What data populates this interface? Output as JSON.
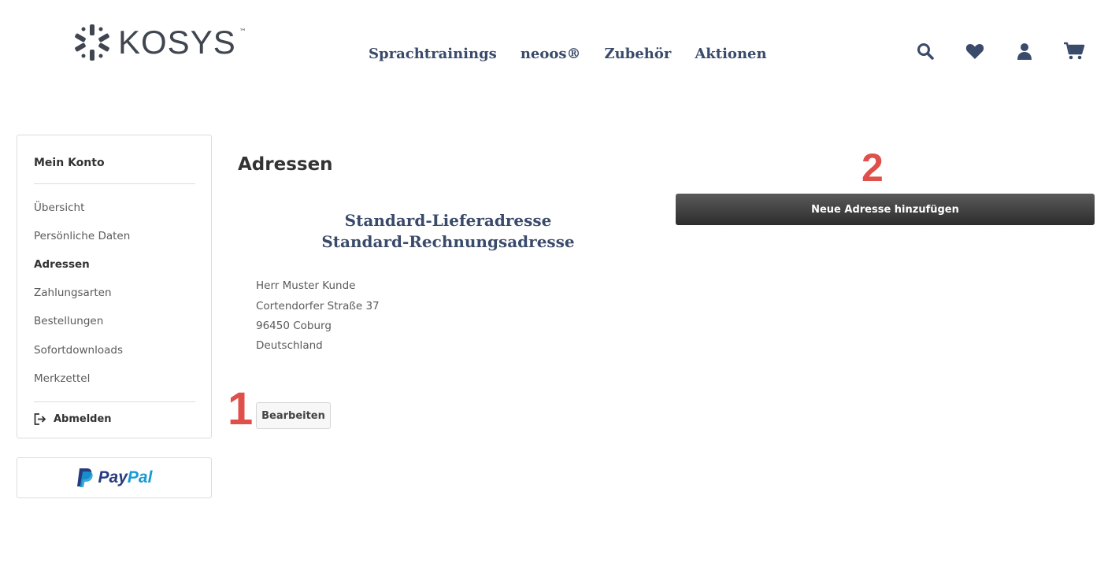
{
  "brand": {
    "name": "KOSYS",
    "trademark": "™"
  },
  "nav": {
    "items": [
      "Sprachtrainings",
      "neoos®",
      "Zubehör",
      "Aktionen"
    ]
  },
  "header_icons": [
    "search-icon",
    "heart-icon",
    "user-icon",
    "cart-icon"
  ],
  "sidebar": {
    "title": "Mein Konto",
    "items": [
      "Übersicht",
      "Persönliche Daten",
      "Adressen",
      "Zahlungsarten",
      "Bestellungen",
      "Sofortdownloads",
      "Merkzettel"
    ],
    "active_item": "Adressen",
    "logout_label": "Abmelden"
  },
  "paypal": {
    "label_part1": "Pay",
    "label_part2": "Pal"
  },
  "main": {
    "title": "Adressen",
    "address_heading_1": "Standard-Lieferadresse",
    "address_heading_2": "Standard-Rechnungsadresse",
    "address_lines": [
      "Herr Muster Kunde",
      "Cortendorfer Straße 37",
      "96450 Coburg",
      "Deutschland"
    ],
    "edit_label": "Bearbeiten",
    "new_address_label": "Neue Adresse hinzufügen"
  },
  "markers": {
    "one": "1",
    "two": "2"
  },
  "colors": {
    "accent_red": "#e0504a",
    "nav_blue": "#3a4a6b",
    "button_dark": "#3a3a3a"
  }
}
